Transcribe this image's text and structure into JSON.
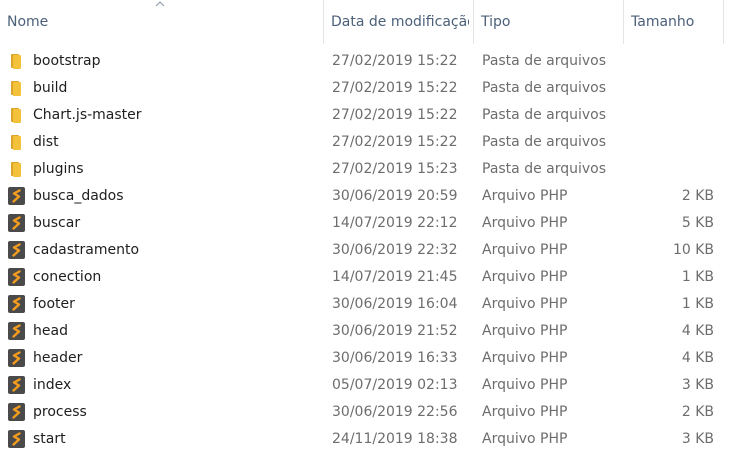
{
  "columns": {
    "name": "Nome",
    "date": "Data de modificação",
    "type": "Tipo",
    "size": "Tamanho"
  },
  "sort": {
    "column": "name",
    "direction": "ascending",
    "icon": "chevron-up-icon"
  },
  "colors": {
    "folder": "#f3c13a",
    "folder_dark": "#dba52b",
    "php_icon_bg": "#4a4a4a",
    "php_icon_accent": "#f39c1f",
    "header_text": "#4c607a",
    "name_text": "#1e1e1e",
    "meta_text": "#6d6d6d"
  },
  "files": [
    {
      "name": "bootstrap",
      "date": "27/02/2019 15:22",
      "type": "Pasta de arquivos",
      "size": "",
      "icon": "folder-icon"
    },
    {
      "name": "build",
      "date": "27/02/2019 15:22",
      "type": "Pasta de arquivos",
      "size": "",
      "icon": "folder-icon"
    },
    {
      "name": "Chart.js-master",
      "date": "27/02/2019 15:22",
      "type": "Pasta de arquivos",
      "size": "",
      "icon": "folder-icon"
    },
    {
      "name": "dist",
      "date": "27/02/2019 15:22",
      "type": "Pasta de arquivos",
      "size": "",
      "icon": "folder-icon"
    },
    {
      "name": "plugins",
      "date": "27/02/2019 15:23",
      "type": "Pasta de arquivos",
      "size": "",
      "icon": "folder-icon"
    },
    {
      "name": "busca_dados",
      "date": "30/06/2019 20:59",
      "type": "Arquivo PHP",
      "size": "2 KB",
      "icon": "php-file-icon"
    },
    {
      "name": "buscar",
      "date": "14/07/2019 22:12",
      "type": "Arquivo PHP",
      "size": "5 KB",
      "icon": "php-file-icon"
    },
    {
      "name": "cadastramento",
      "date": "30/06/2019 22:32",
      "type": "Arquivo PHP",
      "size": "10 KB",
      "icon": "php-file-icon"
    },
    {
      "name": "conection",
      "date": "14/07/2019 21:45",
      "type": "Arquivo PHP",
      "size": "1 KB",
      "icon": "php-file-icon"
    },
    {
      "name": "footer",
      "date": "30/06/2019 16:04",
      "type": "Arquivo PHP",
      "size": "1 KB",
      "icon": "php-file-icon"
    },
    {
      "name": "head",
      "date": "30/06/2019 21:52",
      "type": "Arquivo PHP",
      "size": "4 KB",
      "icon": "php-file-icon"
    },
    {
      "name": "header",
      "date": "30/06/2019 16:33",
      "type": "Arquivo PHP",
      "size": "4 KB",
      "icon": "php-file-icon"
    },
    {
      "name": "index",
      "date": "05/07/2019 02:13",
      "type": "Arquivo PHP",
      "size": "3 KB",
      "icon": "php-file-icon"
    },
    {
      "name": "process",
      "date": "30/06/2019 22:56",
      "type": "Arquivo PHP",
      "size": "2 KB",
      "icon": "php-file-icon"
    },
    {
      "name": "start",
      "date": "24/11/2019 18:38",
      "type": "Arquivo PHP",
      "size": "3 KB",
      "icon": "php-file-icon"
    }
  ]
}
